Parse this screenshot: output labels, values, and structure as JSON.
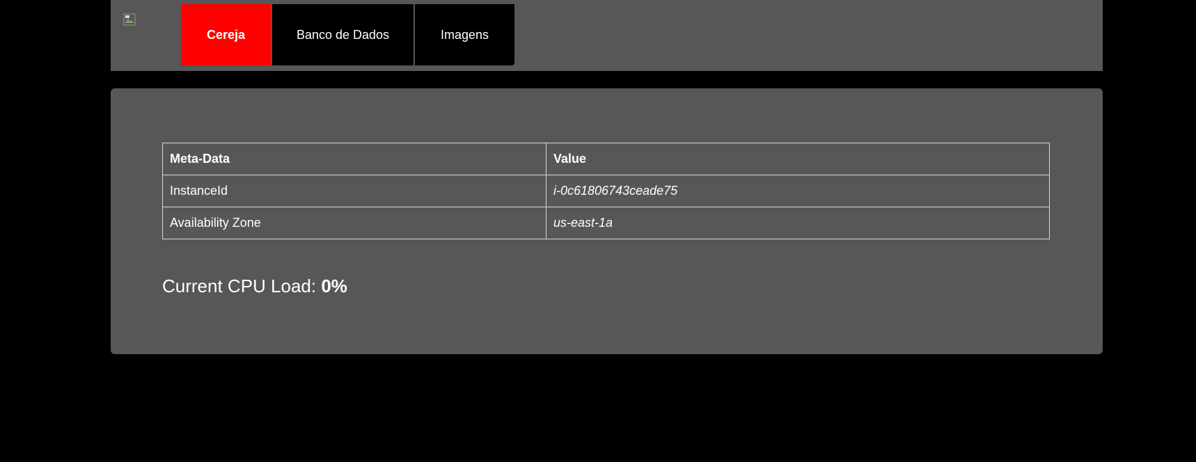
{
  "header": {
    "logo_icon": "broken-image-icon",
    "nav": [
      {
        "label": "Cereja",
        "active": true
      },
      {
        "label": "Banco de Dados",
        "active": false
      },
      {
        "label": "Imagens",
        "active": false
      }
    ],
    "active_color": "#ff0000"
  },
  "main": {
    "table": {
      "headers": [
        "Meta-Data",
        "Value"
      ],
      "rows": [
        {
          "key": "InstanceId",
          "value": "i-0c61806743ceade75"
        },
        {
          "key": "Availability Zone",
          "value": "us-east-1a"
        }
      ]
    },
    "cpu": {
      "label": "Current CPU Load: ",
      "value": "0%"
    }
  }
}
